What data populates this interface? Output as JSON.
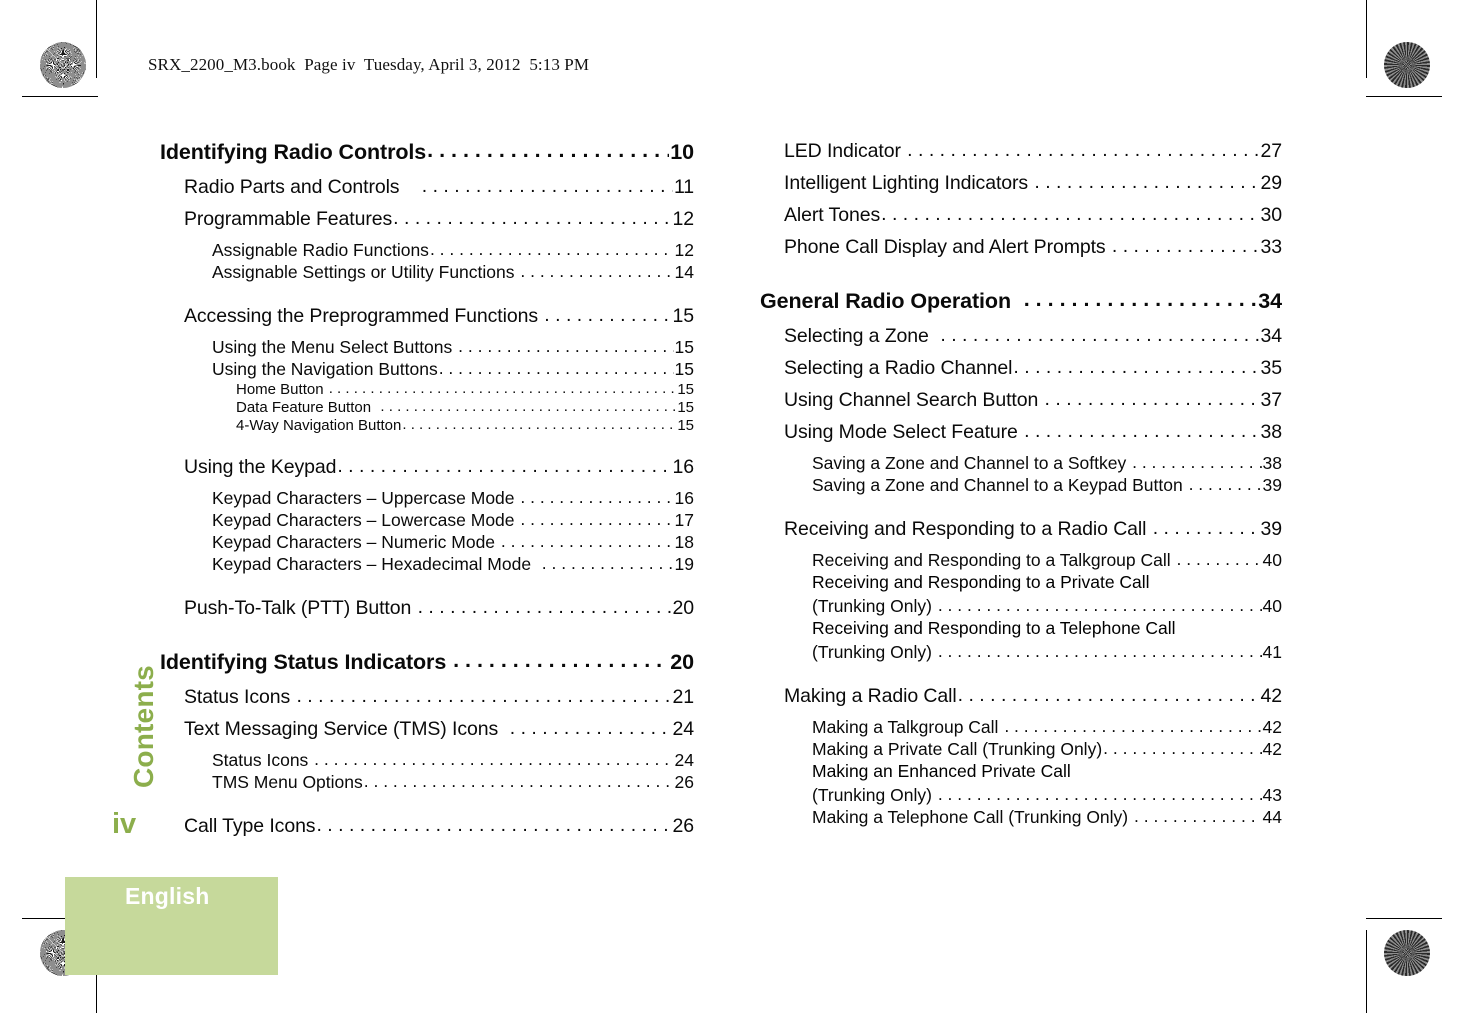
{
  "book_header": "SRX_2200_M3.book  Page iv  Tuesday, April 3, 2012  5:13 PM",
  "side_tab": {
    "chapter_label": "Contents",
    "folio": "iv"
  },
  "language_band": {
    "label": "English",
    "background_color": "#c6d99b",
    "text_color": "#ffffff"
  },
  "accent_color": "#8cae4c",
  "columns": {
    "left": [
      {
        "level": 0,
        "title": "Identifying Radio Controls",
        "page": "10"
      },
      {
        "level": 1,
        "title": "Radio Parts and Controls    ",
        "page": "11"
      },
      {
        "level": 1,
        "title": "Programmable Features",
        "page": "12"
      },
      {
        "level": 2,
        "title": "Assignable Radio Functions",
        "page": "12"
      },
      {
        "level": 2,
        "title": "Assignable Settings or Utility Functions ",
        "page": "14"
      },
      {
        "level": 1,
        "title": "Accessing the Preprogrammed Functions ",
        "page": "15"
      },
      {
        "level": 2,
        "title": "Using the Menu Select Buttons ",
        "page": "15"
      },
      {
        "level": 2,
        "title": "Using the Navigation Buttons",
        "page": "15"
      },
      {
        "level": 3,
        "title": "Home Button ",
        "page": "15"
      },
      {
        "level": 3,
        "title": "Data Feature Button  ",
        "page": "15"
      },
      {
        "level": 3,
        "title": "4-Way Navigation Button",
        "page": "15"
      },
      {
        "level": 1,
        "title": "Using the Keypad",
        "page": "16"
      },
      {
        "level": 2,
        "title": "Keypad Characters – Uppercase Mode ",
        "page": "16"
      },
      {
        "level": 2,
        "title": "Keypad Characters – Lowercase Mode ",
        "page": "17"
      },
      {
        "level": 2,
        "title": "Keypad Characters – Numeric Mode ",
        "page": "18"
      },
      {
        "level": 2,
        "title": "Keypad Characters – Hexadecimal Mode  ",
        "page": "19"
      },
      {
        "level": 1,
        "title": "Push-To-Talk (PTT) Button ",
        "page": "20"
      },
      {
        "level": 0,
        "title": "Identifying Status Indicators ",
        "page": "20"
      },
      {
        "level": 1,
        "title": "Status Icons ",
        "page": "21"
      },
      {
        "level": 1,
        "title": "Text Messaging Service (TMS) Icons  ",
        "page": "24"
      },
      {
        "level": 2,
        "title": "Status Icons ",
        "page": "24"
      },
      {
        "level": 2,
        "title": "TMS Menu Options",
        "page": "26"
      },
      {
        "level": 1,
        "title": "Call Type Icons",
        "page": "26"
      }
    ],
    "right": [
      {
        "level": 1,
        "title": "LED Indicator ",
        "page": "27"
      },
      {
        "level": 1,
        "title": "Intelligent Lighting Indicators ",
        "page": "29"
      },
      {
        "level": 1,
        "title": "Alert Tones",
        "page": "30"
      },
      {
        "level": 1,
        "title": "Phone Call Display and Alert Prompts ",
        "page": "33"
      },
      {
        "level": 0,
        "title": "General Radio Operation  ",
        "page": "34"
      },
      {
        "level": 1,
        "title": "Selecting a Zone  ",
        "page": "34"
      },
      {
        "level": 1,
        "title": "Selecting a Radio Channel",
        "page": "35"
      },
      {
        "level": 1,
        "title": "Using Channel Search Button ",
        "page": "37"
      },
      {
        "level": 1,
        "title": "Using Mode Select Feature ",
        "page": "38"
      },
      {
        "level": 2,
        "title": "Saving a Zone and Channel to a Softkey ",
        "page": "38"
      },
      {
        "level": 2,
        "title": "Saving a Zone and Channel to a Keypad Button ",
        "page": "39"
      },
      {
        "level": 1,
        "title": "Receiving and Responding to a Radio Call ",
        "page": "39"
      },
      {
        "level": 2,
        "title": "Receiving and Responding to a Talkgroup Call ",
        "page": "40"
      },
      {
        "level": 2,
        "wrap_first": "Receiving and Responding to a Private Call",
        "title": "(Trunking Only) ",
        "page": "40"
      },
      {
        "level": 2,
        "wrap_first": "Receiving and Responding to a Telephone Call",
        "title": "(Trunking Only) ",
        "page": "41"
      },
      {
        "level": 1,
        "title": "Making a Radio Call",
        "page": "42"
      },
      {
        "level": 2,
        "title": "Making a Talkgroup Call ",
        "page": "42"
      },
      {
        "level": 2,
        "title": "Making a Private Call (Trunking Only)",
        "page": "42"
      },
      {
        "level": 2,
        "wrap_first": "Making an Enhanced Private Call",
        "title": "(Trunking Only) ",
        "page": "43"
      },
      {
        "level": 2,
        "title": "Making a Telephone Call (Trunking Only) ",
        "page": "44"
      }
    ]
  }
}
